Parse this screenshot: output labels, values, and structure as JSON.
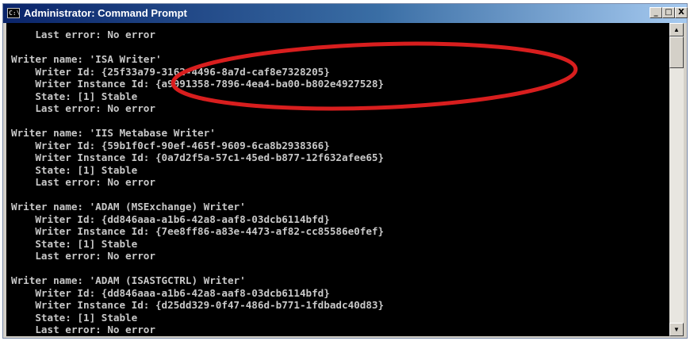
{
  "window": {
    "title": "Administrator: Command Prompt",
    "icon_label": "C:\\",
    "controls": {
      "minimize": "_",
      "maximize": "□",
      "close": "X"
    }
  },
  "console": {
    "lines": [
      "    Last error: No error",
      "",
      "Writer name: 'ISA Writer'",
      "    Writer Id: {25f33a79-3162-4496-8a7d-caf8e7328205}",
      "    Writer Instance Id: {a9991358-7896-4ea4-ba00-b802e4927528}",
      "    State: [1] Stable",
      "    Last error: No error",
      "",
      "Writer name: 'IIS Metabase Writer'",
      "    Writer Id: {59b1f0cf-90ef-465f-9609-6ca8b2938366}",
      "    Writer Instance Id: {0a7d2f5a-57c1-45ed-b877-12f632afee65}",
      "    State: [1] Stable",
      "    Last error: No error",
      "",
      "Writer name: 'ADAM (MSExchange) Writer'",
      "    Writer Id: {dd846aaa-a1b6-42a8-aaf8-03dcb6114bfd}",
      "    Writer Instance Id: {7ee8ff86-a83e-4473-af82-cc85586e0fef}",
      "    State: [1] Stable",
      "    Last error: No error",
      "",
      "Writer name: 'ADAM (ISASTGCTRL) Writer'",
      "    Writer Id: {dd846aaa-a1b6-42a8-aaf8-03dcb6114bfd}",
      "    Writer Instance Id: {d25dd329-0f47-486d-b771-1fdbadc40d83}",
      "    State: [1] Stable",
      "    Last error: No error"
    ]
  },
  "scrollbar": {
    "up_glyph": "▲",
    "down_glyph": "▼"
  },
  "annotation": {
    "color": "#d81e1e"
  },
  "colors": {
    "console_bg": "#000000",
    "console_text": "#c8c8c8",
    "titlebar_start": "#0a246a",
    "titlebar_end": "#a6caf0"
  }
}
